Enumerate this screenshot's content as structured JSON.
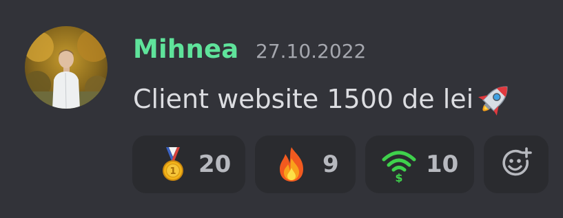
{
  "message": {
    "author": "Mihnea",
    "timestamp": "27.10.2022",
    "text": "Client website 1500 de lei",
    "text_emoji": "rocket-icon"
  },
  "reactions": [
    {
      "emoji": "medal-icon",
      "count": "20"
    },
    {
      "emoji": "fire-icon",
      "count": "9"
    },
    {
      "emoji": "wifi-money-icon",
      "count": "10"
    }
  ],
  "add_reaction_icon": "add-reaction-icon",
  "colors": {
    "background": "#323339",
    "username": "#5fe39b",
    "timestamp": "#a5a7ae",
    "text": "#dcdde1",
    "reaction_bg": "#2a2b2f",
    "reaction_count": "#b7b9bf"
  }
}
